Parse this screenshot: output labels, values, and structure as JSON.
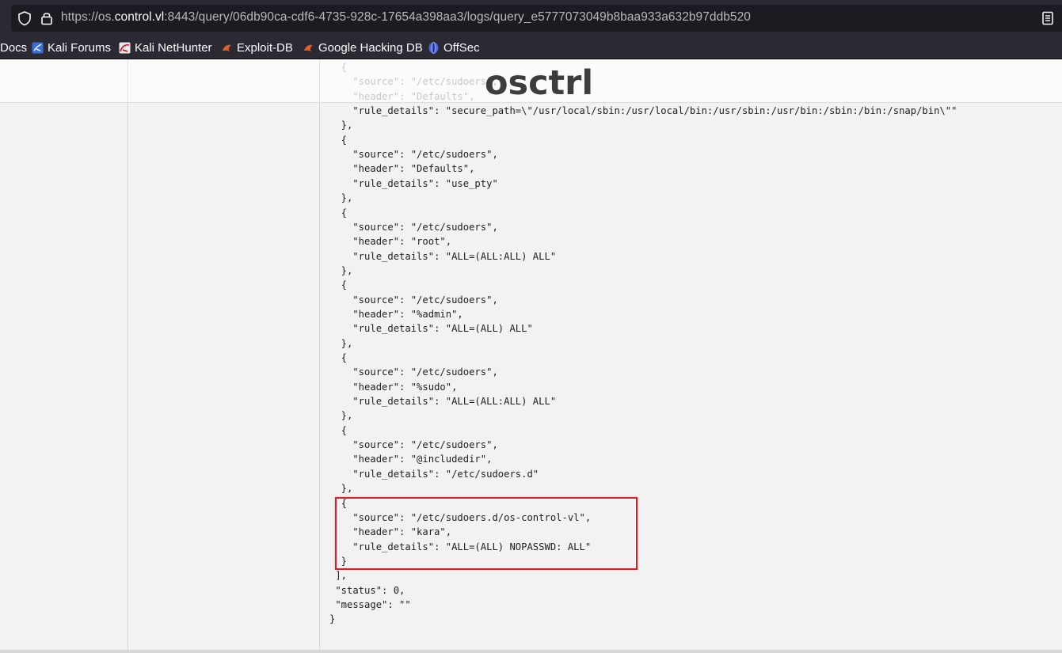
{
  "browser": {
    "url_scheme": "https://os.",
    "url_host": "control.vl",
    "url_rest": ":8443/query/06db90ca-cdf6-4735-928c-17654a398aa3/logs/query_e5777073049b8baa933a632b97ddb520",
    "bookmarks": [
      {
        "label": "Docs",
        "icon": "none"
      },
      {
        "label": "Kali Forums",
        "icon": "kali-forums-icon"
      },
      {
        "label": "Kali NetHunter",
        "icon": "kali-nethunter-icon"
      },
      {
        "label": "Exploit-DB",
        "icon": "exploit-db-icon"
      },
      {
        "label": "Google Hacking DB",
        "icon": "ghdb-icon"
      },
      {
        "label": "OffSec",
        "icon": "offsec-icon"
      }
    ]
  },
  "app": {
    "logo": "osctrl"
  },
  "json_lines": [
    {
      "text": "  {",
      "faded": true
    },
    {
      "text": "    \"source\": \"/etc/sudoers\",",
      "faded": true
    },
    {
      "text": "    \"header\": \"Defaults\",",
      "faded": true
    },
    {
      "text": "    \"rule_details\": \"secure_path=\\\"/usr/local/sbin:/usr/local/bin:/usr/sbin:/usr/bin:/sbin:/bin:/snap/bin\\\"\"",
      "faded": false
    },
    {
      "text": "  },",
      "faded": false
    },
    {
      "text": "  {",
      "faded": false
    },
    {
      "text": "    \"source\": \"/etc/sudoers\",",
      "faded": false
    },
    {
      "text": "    \"header\": \"Defaults\",",
      "faded": false
    },
    {
      "text": "    \"rule_details\": \"use_pty\"",
      "faded": false
    },
    {
      "text": "  },",
      "faded": false
    },
    {
      "text": "  {",
      "faded": false
    },
    {
      "text": "    \"source\": \"/etc/sudoers\",",
      "faded": false
    },
    {
      "text": "    \"header\": \"root\",",
      "faded": false
    },
    {
      "text": "    \"rule_details\": \"ALL=(ALL:ALL) ALL\"",
      "faded": false
    },
    {
      "text": "  },",
      "faded": false
    },
    {
      "text": "  {",
      "faded": false
    },
    {
      "text": "    \"source\": \"/etc/sudoers\",",
      "faded": false
    },
    {
      "text": "    \"header\": \"%admin\",",
      "faded": false
    },
    {
      "text": "    \"rule_details\": \"ALL=(ALL) ALL\"",
      "faded": false
    },
    {
      "text": "  },",
      "faded": false
    },
    {
      "text": "  {",
      "faded": false
    },
    {
      "text": "    \"source\": \"/etc/sudoers\",",
      "faded": false
    },
    {
      "text": "    \"header\": \"%sudo\",",
      "faded": false
    },
    {
      "text": "    \"rule_details\": \"ALL=(ALL:ALL) ALL\"",
      "faded": false
    },
    {
      "text": "  },",
      "faded": false
    },
    {
      "text": "  {",
      "faded": false
    },
    {
      "text": "    \"source\": \"/etc/sudoers\",",
      "faded": false
    },
    {
      "text": "    \"header\": \"@includedir\",",
      "faded": false
    },
    {
      "text": "    \"rule_details\": \"/etc/sudoers.d\"",
      "faded": false
    },
    {
      "text": "  },",
      "faded": false
    },
    {
      "text": "  {",
      "faded": false
    },
    {
      "text": "    \"source\": \"/etc/sudoers.d/os-control-vl\",",
      "faded": false
    },
    {
      "text": "    \"header\": \"kara\",",
      "faded": false
    },
    {
      "text": "    \"rule_details\": \"ALL=(ALL) NOPASSWD: ALL\"",
      "faded": false
    },
    {
      "text": "  }",
      "faded": false
    },
    {
      "text": " ],",
      "faded": false
    },
    {
      "text": " \"status\": 0,",
      "faded": false
    },
    {
      "text": " \"message\": \"\"",
      "faded": false
    },
    {
      "text": "}",
      "faded": false
    }
  ],
  "highlight": {
    "color": "#d0202a",
    "covers": "kara sudoers.d entry"
  }
}
